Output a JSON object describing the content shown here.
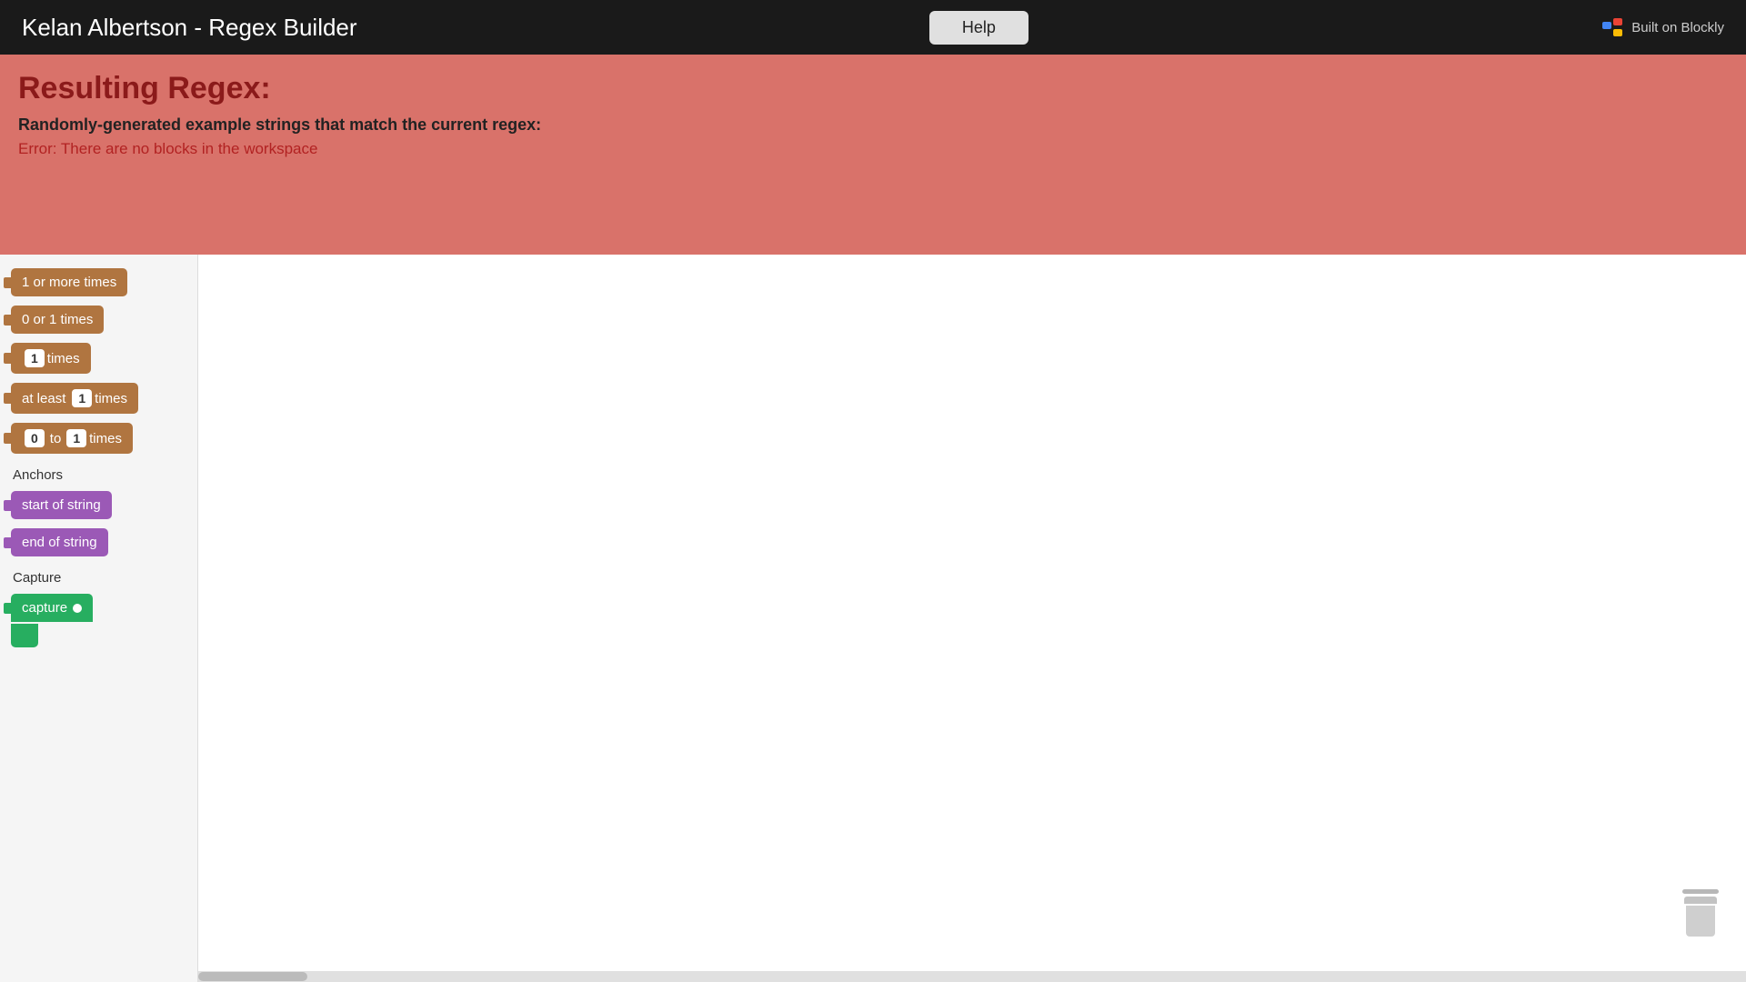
{
  "titlebar": {
    "title": "Kelan Albertson - Regex Builder",
    "help_label": "Help",
    "blockly_label": "Built on Blockly"
  },
  "regex_area": {
    "title": "Resulting Regex:",
    "subtitle": "Randomly-generated example strings that match the current regex:",
    "error": "Error: There are no blocks in the workspace"
  },
  "sidebar": {
    "blocks": [
      {
        "id": "one-or-more",
        "label": "1 or more times",
        "type": "brown"
      },
      {
        "id": "zero-or-one",
        "label": "0 or 1 times",
        "type": "brown"
      },
      {
        "id": "n-times",
        "label": "times",
        "type": "brown",
        "num": "1"
      },
      {
        "id": "at-least",
        "label": "times",
        "type": "brown",
        "prefix": "at least",
        "num": "1"
      },
      {
        "id": "range",
        "label": "times",
        "type": "brown",
        "from": "0",
        "to": "1"
      }
    ],
    "anchors_label": "Anchors",
    "anchors": [
      {
        "id": "start-of-string",
        "label": "start of string",
        "type": "purple"
      },
      {
        "id": "end-of-string",
        "label": "end of string",
        "type": "purple"
      }
    ],
    "capture_label": "Capture",
    "capture": {
      "id": "capture",
      "label": "capture",
      "type": "green"
    }
  }
}
